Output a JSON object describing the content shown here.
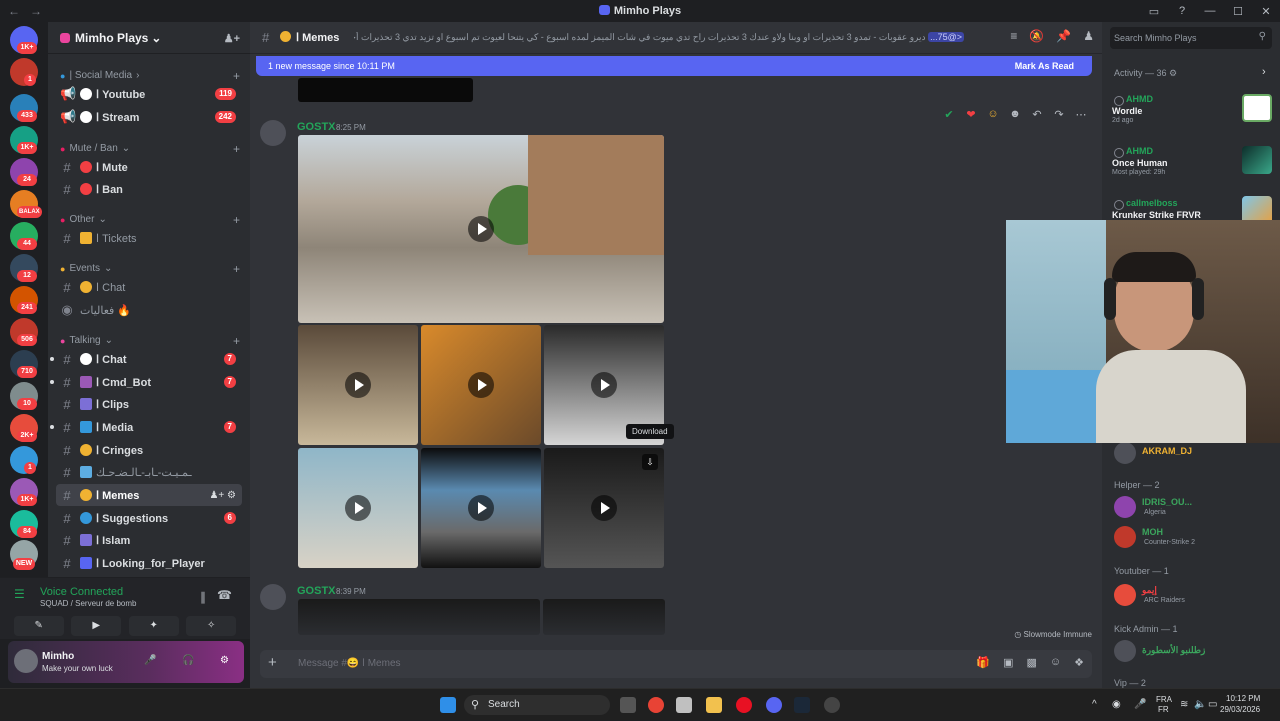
{
  "window": {
    "title": "Mimho Plays",
    "back": "←",
    "forward": "→",
    "controls": [
      "▭",
      "?",
      "—",
      "☐",
      "✕"
    ]
  },
  "guilds": [
    {
      "badge": "1K+"
    },
    {
      "badge": "1"
    },
    {
      "badge": "433"
    },
    {
      "badge": "1K+"
    },
    {
      "badge": "24"
    },
    {
      "badge": "BALAX"
    },
    {
      "badge": "44"
    },
    {
      "badge": "12"
    },
    {
      "badge": "241"
    },
    {
      "badge": "506"
    },
    {
      "badge": "710"
    },
    {
      "badge": "10"
    },
    {
      "badge": "2K+"
    },
    {
      "badge": "1"
    },
    {
      "badge": "1K+"
    },
    {
      "badge": "84"
    },
    {
      "badge": "NEW"
    }
  ],
  "server": {
    "name": "Mimho Plays",
    "chevron": "⌄"
  },
  "categories": {
    "social": "| Social Media",
    "mute": "Mute / Ban",
    "other": "Other",
    "events": "Events",
    "talking": "Talking"
  },
  "channels": {
    "youtube": {
      "name": "ا Youtube",
      "count": "119"
    },
    "stream": {
      "name": "ا Stream",
      "count": "242"
    },
    "mute": {
      "name": "ا Mute"
    },
    "ban": {
      "name": "ا Ban"
    },
    "tickets": {
      "name": "ا Tickets"
    },
    "chat_event": {
      "name": "ا Chat"
    },
    "events_voice": {
      "name": "فعاليات 🔥"
    },
    "chat": {
      "name": "ا Chat",
      "count": "7"
    },
    "cmd_bot": {
      "name": "ا Cmd_Bot",
      "count": "7"
    },
    "clips": {
      "name": "ا Clips"
    },
    "media": {
      "name": "ا Media",
      "count": "7"
    },
    "cringes": {
      "name": "ا Cringes"
    },
    "cringe_ar": {
      "name": "ـمـيـت-ـا‌بـ-ـالـضـ‌حـك"
    },
    "memes": {
      "name": "ا Memes"
    },
    "suggestions": {
      "name": "ا Suggestions",
      "count": "6"
    },
    "islam": {
      "name": "ا Islam"
    },
    "looking": {
      "name": "ا Looking_for_Player"
    }
  },
  "voice": {
    "status": "Voice Connected",
    "sub": "SQUAD / Serveur de bomb",
    "buttons": [
      "✎",
      "▶",
      "✦",
      "✧"
    ]
  },
  "user": {
    "name": "Mimho",
    "status": "Make your own luck",
    "icons": [
      "🎤",
      "🎧",
      "⚙"
    ]
  },
  "header": {
    "channel": "ا Memes",
    "topic": "ديرو عقوبات - تمدو 3 تحذيرات او وبنا ولاو عندك 3 تحذيرات راح تدي ميوت في شات الميمز لمده اسبوع - كي يتنحا لعيوت تم اسبوع او تزيد تدي 3 تحذيرات أخرى راح تدي ميوت تم شهر من شات الميمز",
    "mention": "<@75..."
  },
  "banner": {
    "text": "1 new message since 10:11 PM",
    "action": "Mark As Read"
  },
  "messages": [
    {
      "author": "GOSTX",
      "time": "8:25 PM"
    },
    {
      "author": "GOSTX",
      "time": "8:39 PM"
    }
  ],
  "tooltip": "Download",
  "slowmode": "Slowmode Immune",
  "composer": {
    "placeholder": "Message #😄 ا Memes"
  },
  "search": {
    "placeholder": "Search Mimho Plays"
  },
  "activity": {
    "header": "Activity — 36",
    "items": [
      {
        "user": "AHMD",
        "game": "Wordle",
        "sub": "2d ago"
      },
      {
        "user": "AHMD",
        "game": "Once Human",
        "sub": "Most played: 29h"
      },
      {
        "user": "callmelboss",
        "game": "Krunker Strike FRVR",
        "sub": ""
      }
    ]
  },
  "members": {
    "top": {
      "name": "AKRAM_DJ"
    },
    "helper_h": "Helper — 2",
    "helpers": [
      {
        "name": "IDRIS_OU...",
        "game": "Algeria",
        "color": "#3ba55d"
      },
      {
        "name": "MOH",
        "game": "Counter-Strike 2",
        "color": "#3ba55d"
      }
    ],
    "youtuber_h": "Youtuber — 1",
    "youtubers": [
      {
        "name": "إيمو",
        "game": "ARC Raiders",
        "color": "#f23f43"
      }
    ],
    "kickadmin_h": "Kick Admin — 1",
    "kickadmins": [
      {
        "name": "زطلنبو الأسطورة",
        "color": "#3ba55d"
      }
    ],
    "vip_h": "Vip — 2"
  },
  "taskbar": {
    "search": "Search",
    "lang1": "FRA",
    "lang2": "FR",
    "time": "10:12 PM",
    "date": "29/03/2026"
  },
  "colors": {
    "accent": "#5865f2",
    "online": "#23a55a",
    "danger": "#f23f43"
  }
}
